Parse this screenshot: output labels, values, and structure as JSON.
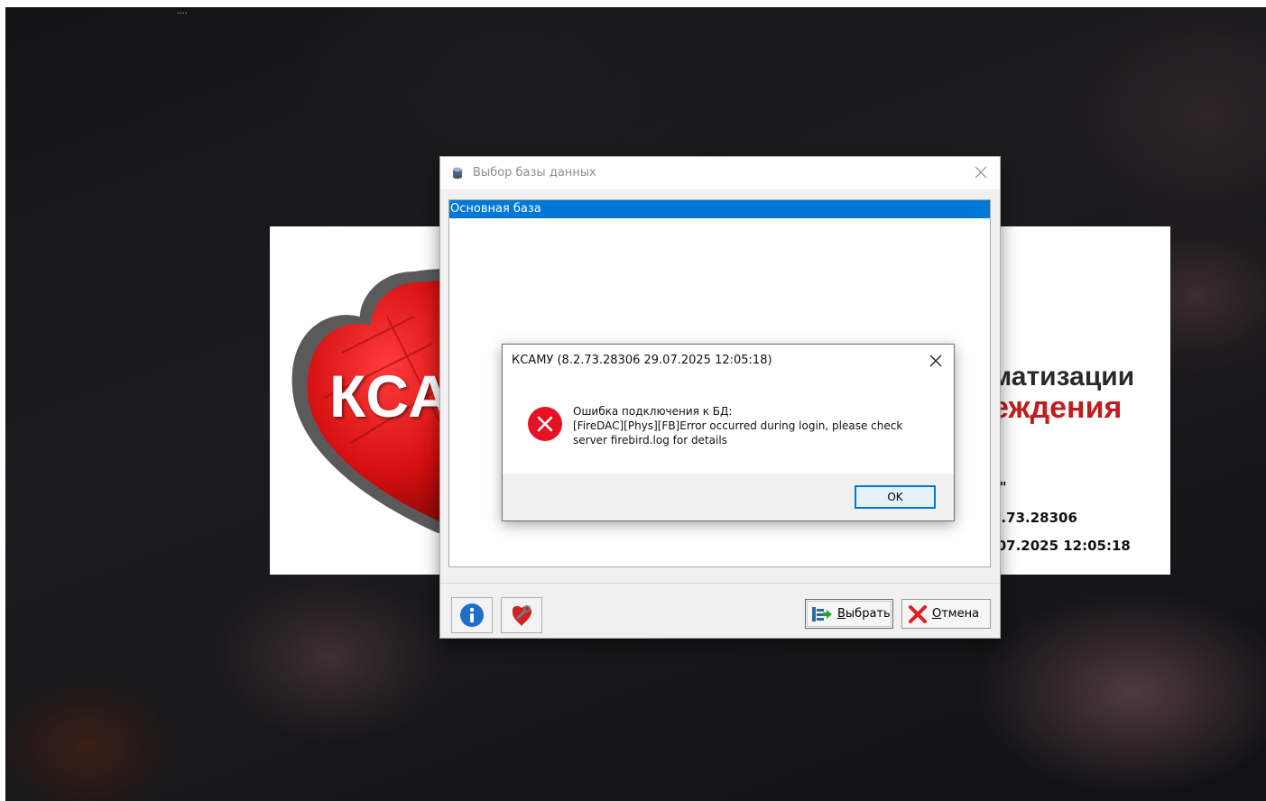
{
  "desktop": {
    "label": "...."
  },
  "splash": {
    "logo_text": "КСА",
    "line1": "матизации",
    "line2": "еждения",
    "line3": "т\"",
    "line4": "2.73.28306",
    "line5": ".07.2025 12:05:18"
  },
  "db_window": {
    "title": "Выбор базы данных",
    "title_icon": "database-icon",
    "databases": [
      {
        "name": "Основная база",
        "selected": true
      }
    ],
    "buttons": {
      "info_icon": "info-icon",
      "repair_icon": "repair-icon",
      "select_prefix": "",
      "select_underlined": "В",
      "select_rest": "ыбрать",
      "cancel_underlined": "О",
      "cancel_rest": "тмена"
    }
  },
  "error_dialog": {
    "title": "КСАМУ (8.2.73.28306 29.07.2025 12:05:18)",
    "icon": "error-icon",
    "message_lines": [
      "Ошибка подключения к БД:",
      "[FireDAC][Phys][FB]Error occurred during login, please check",
      "server firebird.log for details"
    ],
    "ok_label": "OK"
  },
  "colors": {
    "selection": "#0078d7",
    "error_red": "#e81123",
    "brand_red": "#c21c1c"
  }
}
